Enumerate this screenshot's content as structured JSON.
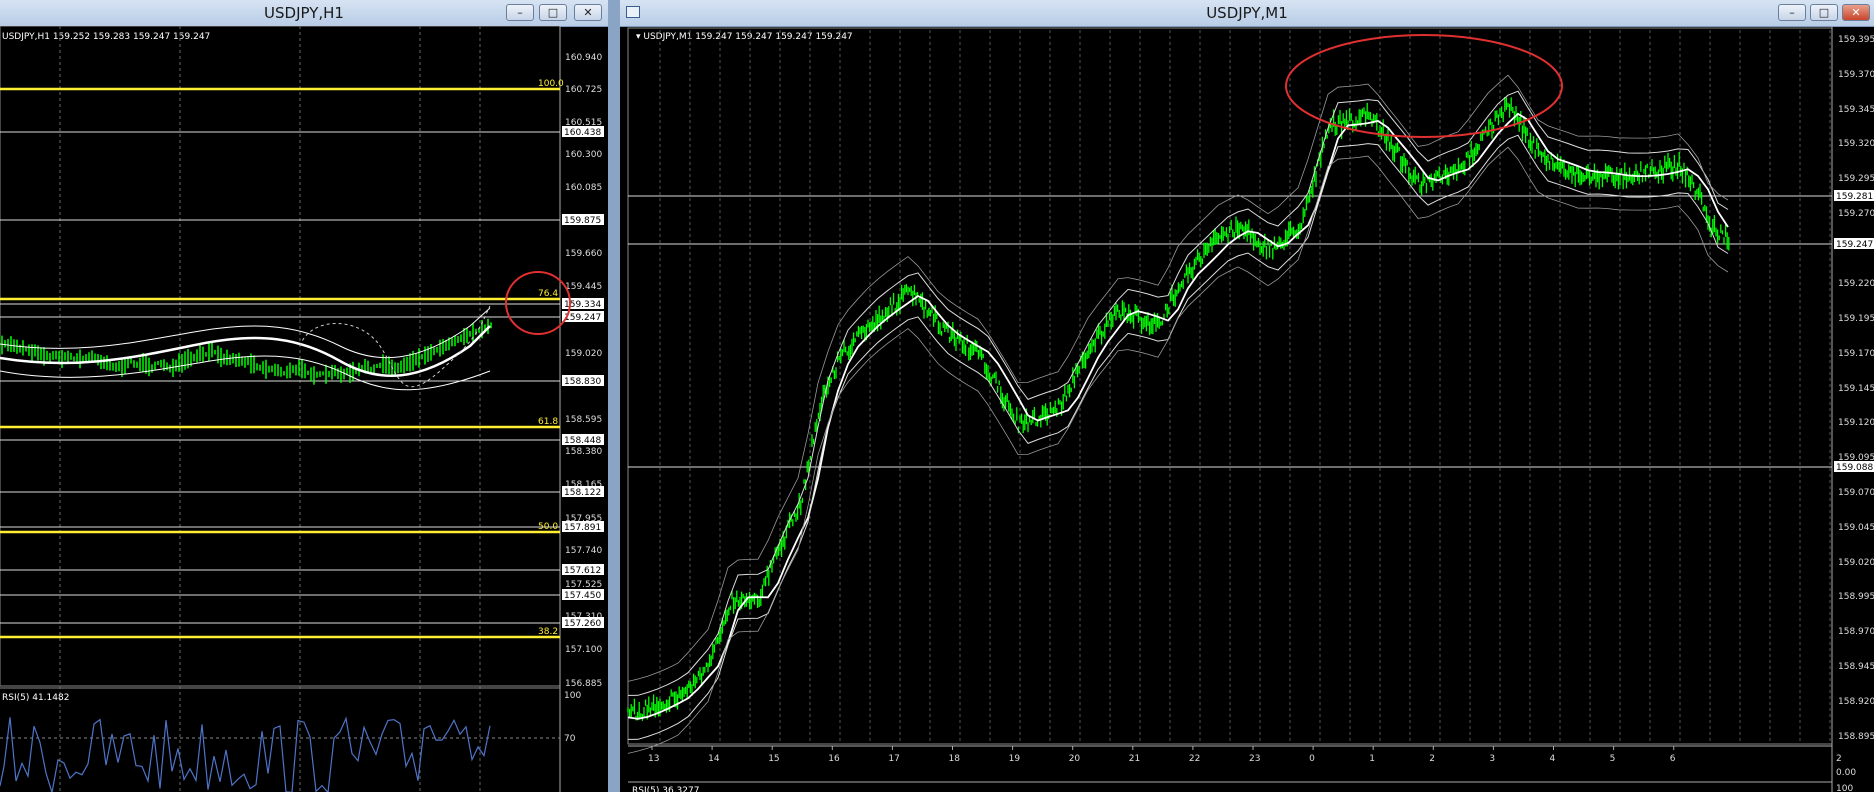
{
  "left_window": {
    "title": "USDJPY,H1",
    "info": "USDJPY,H1  159.252 159.283 159.247 159.247",
    "price_axis": [
      "160.940",
      "160.725",
      "160.515",
      "160.300",
      "160.085",
      "159.660",
      "159.445",
      "159.020",
      "158.595",
      "158.380",
      "158.165",
      "157.955",
      "157.740",
      "157.525",
      "157.310",
      "157.100",
      "156.885"
    ],
    "price_boxes": [
      "160.438",
      "159.875",
      "159.334",
      "159.247",
      "158.830",
      "158.448",
      "158.122",
      "157.891",
      "157.612",
      "157.450",
      "157.260"
    ],
    "fibo_levels": [
      "100.0",
      "76.4",
      "61.8",
      "50.0",
      "38.2"
    ],
    "rsi_label": "RSI(5) 41.1482",
    "rsi_axis": [
      "100",
      "70"
    ]
  },
  "right_window": {
    "title": "USDJPY,M1",
    "info": "USDJPY,M1  159.247 159.247 159.247 159.247",
    "price_axis": [
      "159.395",
      "159.370",
      "159.345",
      "159.320",
      "159.295",
      "159.270",
      "159.220",
      "159.195",
      "159.170",
      "159.145",
      "159.120",
      "159.095",
      "159.070",
      "159.045",
      "159.020",
      "158.995",
      "158.970",
      "158.945",
      "158.920",
      "158.895"
    ],
    "price_boxes": [
      "159.281",
      "159.247",
      "159.088"
    ],
    "time_axis": [
      "13",
      "14",
      "15",
      "16",
      "17",
      "18",
      "19",
      "20",
      "21",
      "22",
      "23",
      "0",
      "1",
      "2",
      "3",
      "4",
      "5",
      "6"
    ],
    "rsi_label": "RSI(5) 36.3277",
    "rsi_axis": [
      "2",
      "0.00",
      "100"
    ]
  },
  "colors": {
    "candles": "#00ff00",
    "fibo": "#ffee33",
    "annotation": "#e03030",
    "rsi": "#4f74c8"
  }
}
